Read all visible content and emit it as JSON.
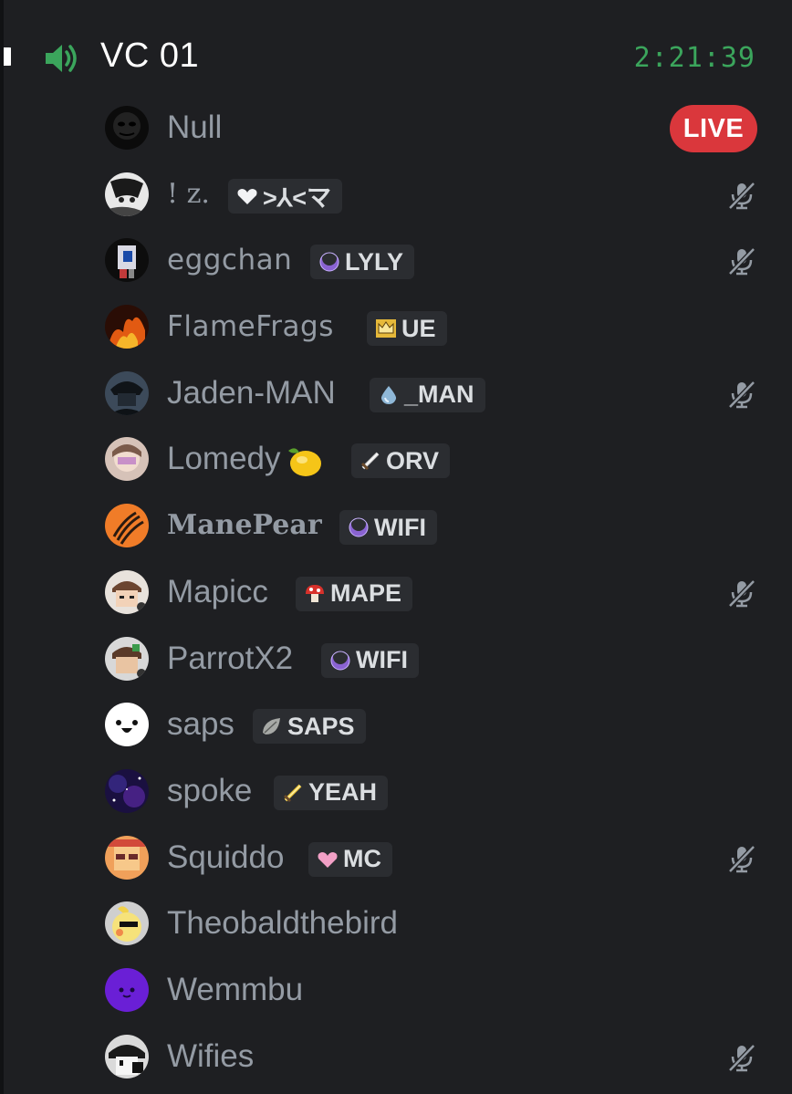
{
  "channel": {
    "name": "VC 01",
    "timer": "2:21:39",
    "icon": "speaker-icon"
  },
  "users": [
    {
      "name": "Null",
      "tag": null,
      "live": "LIVE",
      "muted": false
    },
    {
      "name": "! z.",
      "tag": {
        "icon": "heart-white",
        "label": ">⅄<マ"
      },
      "muted": true
    },
    {
      "name": "eggchan",
      "tag": {
        "icon": "moon-purple",
        "label": "LYLY"
      },
      "muted": true
    },
    {
      "name": "FlameFrags",
      "tag": {
        "icon": "crown-gold",
        "label": "UE"
      },
      "muted": false
    },
    {
      "name": "Jaden-MAN",
      "tag": {
        "icon": "drop-blue",
        "label": "_MAN"
      },
      "muted": true
    },
    {
      "name": "Lomedy",
      "emoji": "lemon",
      "tag": {
        "icon": "sword-silver",
        "label": "ORV"
      },
      "muted": false
    },
    {
      "name": "ManePear",
      "tag": {
        "icon": "moon-purple",
        "label": "WIFI"
      },
      "muted": false
    },
    {
      "name": "Mapicc",
      "tag": {
        "icon": "mushroom-red",
        "label": "MAPE"
      },
      "muted": true
    },
    {
      "name": "ParrotX2",
      "tag": {
        "icon": "moon-purple",
        "label": "WIFI"
      },
      "muted": false
    },
    {
      "name": "saps",
      "tag": {
        "icon": "leaf-gray",
        "label": "SAPS"
      },
      "muted": false
    },
    {
      "name": "spoke",
      "tag": {
        "icon": "sword-gold",
        "label": "YEAH"
      },
      "muted": false
    },
    {
      "name": "Squiddo",
      "tag": {
        "icon": "heart-pink",
        "label": "MC"
      },
      "muted": true
    },
    {
      "name": "Theobaldthebird",
      "tag": null,
      "muted": false
    },
    {
      "name": "Wemmbu",
      "tag": null,
      "muted": false
    },
    {
      "name": "Wifies",
      "tag": null,
      "muted": true
    }
  ],
  "colors": {
    "background": "#1e1f22",
    "timer": "#3ba55c",
    "live": "#da373c",
    "muted_icon": "#949ba4",
    "username": "#949ba4"
  }
}
